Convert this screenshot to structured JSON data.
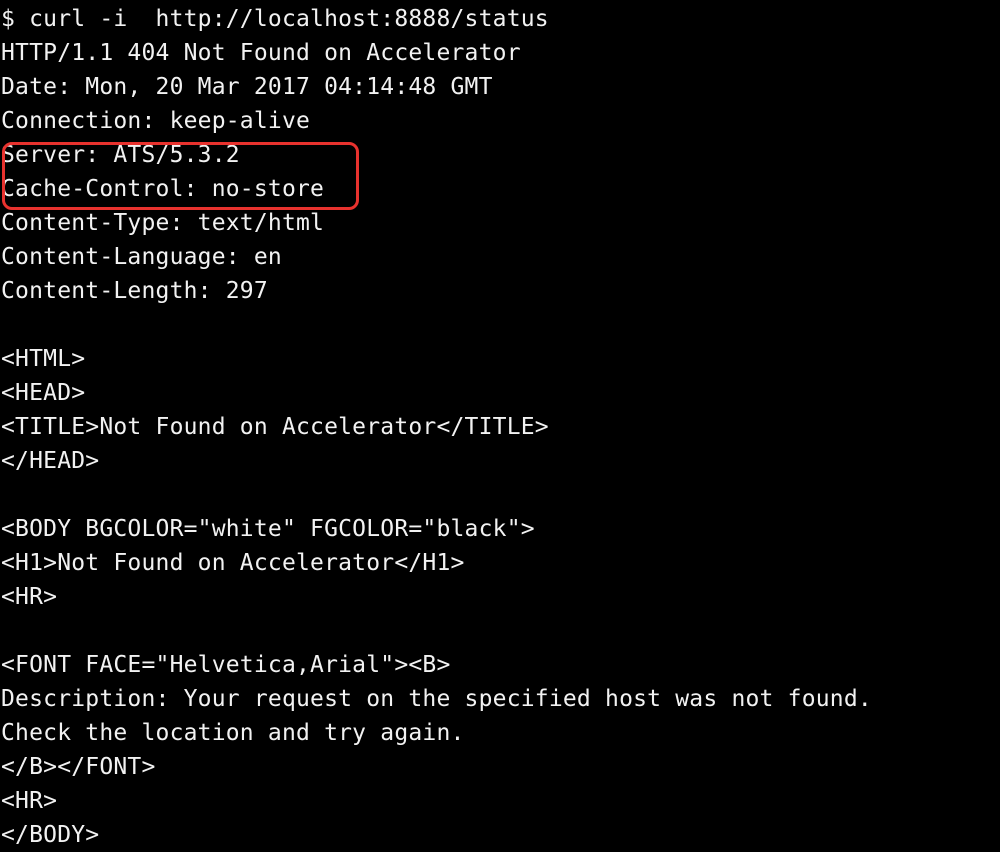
{
  "terminal": {
    "background": "#000000",
    "text_color": "#f2f2f2",
    "highlight_color": "#e8322e",
    "lines": [
      "$ curl -i  http://localhost:8888/status",
      "HTTP/1.1 404 Not Found on Accelerator",
      "Date: Mon, 20 Mar 2017 04:14:48 GMT",
      "Connection: keep-alive",
      "Server: ATS/5.3.2",
      "Cache-Control: no-store",
      "Content-Type: text/html",
      "Content-Language: en",
      "Content-Length: 297",
      "",
      "<HTML>",
      "<HEAD>",
      "<TITLE>Not Found on Accelerator</TITLE>",
      "</HEAD>",
      "",
      "<BODY BGCOLOR=\"white\" FGCOLOR=\"black\">",
      "<H1>Not Found on Accelerator</H1>",
      "<HR>",
      "",
      "<FONT FACE=\"Helvetica,Arial\"><B>",
      "Description: Your request on the specified host was not found.",
      "Check the location and try again.",
      "</B></FONT>",
      "<HR>",
      "</BODY>"
    ]
  }
}
